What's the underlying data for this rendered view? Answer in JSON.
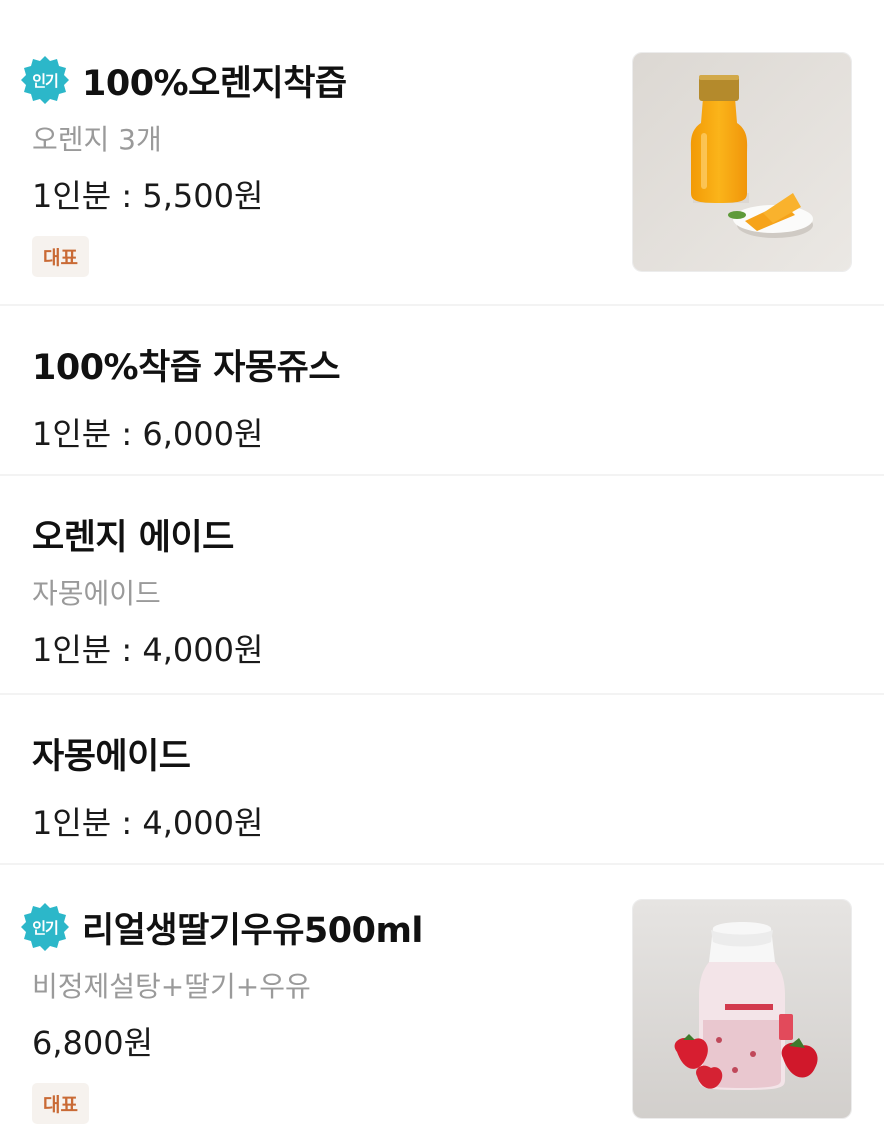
{
  "menu": {
    "items": [
      {
        "name": "100%오렌지착즙",
        "popular_badge": "인기",
        "description": "오렌지 3개",
        "price": "1인분 : 5,500원",
        "tag": "대표",
        "image_icon": "orange-juice-photo"
      },
      {
        "name": "100%착즙 자몽쥬스",
        "price": "1인분 : 6,000원"
      },
      {
        "name": "오렌지 에이드",
        "description": "자몽에이드",
        "price": "1인분 : 4,000원"
      },
      {
        "name": "자몽에이드",
        "price": "1인분 : 4,000원"
      },
      {
        "name": "리얼생딸기우유500ml",
        "popular_badge": "인기",
        "description": "비정제설탕+딸기+우유",
        "price": "6,800원",
        "tag": "대표",
        "image_icon": "strawberry-milk-photo"
      }
    ]
  },
  "colors": {
    "popular_badge": "#2cb7c9",
    "tag_text": "#c96a35",
    "tag_background": "#f6f2ee",
    "description_text": "#9a9a9a"
  }
}
